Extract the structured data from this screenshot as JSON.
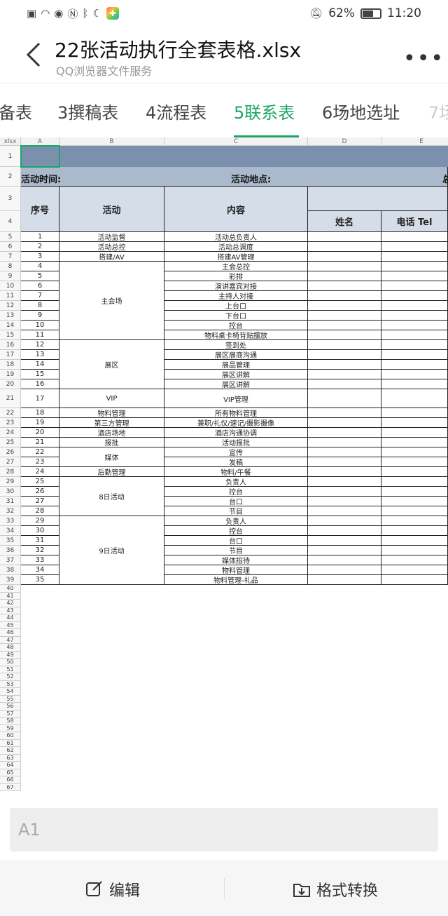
{
  "status_bar": {
    "battery": "62%",
    "time": "11:20",
    "battery_level": 0.62
  },
  "header": {
    "title": "22张活动执行全套表格.xlsx",
    "subtitle": "QQ浏览器文件服务"
  },
  "tabs": [
    "备表",
    "3撰稿表",
    "4流程表",
    "5联系表",
    "6场地选址",
    "7场"
  ],
  "active_tab": "5联系表",
  "sheet": {
    "corner": "xlsx",
    "columns": [
      "A",
      "B",
      "C",
      "D",
      "E"
    ],
    "row2": {
      "time_label": "活动时间:",
      "place_label": "活动地点:",
      "edge": "总"
    },
    "headers": {
      "seq": "序号",
      "activity": "活动",
      "content": "内容",
      "name": "姓名",
      "phone": "电话 Tel"
    },
    "groups": [
      {
        "label": "活动监督",
        "rows": [
          5
        ]
      },
      {
        "label": "活动总控",
        "rows": [
          6
        ]
      },
      {
        "label": "搭建/AV",
        "rows": [
          7
        ]
      },
      {
        "label": "主会场",
        "rows": [
          8,
          9,
          10,
          11,
          12,
          13,
          14,
          15
        ]
      },
      {
        "label": "展区",
        "rows": [
          16,
          17,
          18,
          19,
          20
        ]
      },
      {
        "label": "VIP",
        "rows": [
          21
        ]
      },
      {
        "label": "物料管理",
        "rows": [
          22
        ]
      },
      {
        "label": "第三方管理",
        "rows": [
          23
        ]
      },
      {
        "label": "酒店场地",
        "rows": [
          24
        ]
      },
      {
        "label": "报批",
        "rows": [
          25
        ]
      },
      {
        "label": "媒体",
        "rows": [
          26,
          27
        ]
      },
      {
        "label": "后勤管理",
        "rows": [
          28
        ]
      },
      {
        "label": "8日活动",
        "rows": [
          29,
          30,
          31,
          32
        ]
      },
      {
        "label": "9日活动",
        "rows": [
          33,
          34,
          35,
          36,
          37,
          38,
          39
        ]
      }
    ],
    "rows": [
      {
        "seq": "1",
        "content": "活动总负责人"
      },
      {
        "seq": "2",
        "content": "活动总调度"
      },
      {
        "seq": "3",
        "content": "搭建AV管理"
      },
      {
        "seq": "4",
        "content": "主会总控"
      },
      {
        "seq": "5",
        "content": "彩排"
      },
      {
        "seq": "6",
        "content": "演讲嘉宾对接"
      },
      {
        "seq": "7",
        "content": "主持人对接"
      },
      {
        "seq": "8",
        "content": "上台口"
      },
      {
        "seq": "9",
        "content": "下台口"
      },
      {
        "seq": "10",
        "content": "控台"
      },
      {
        "seq": "11",
        "content": "物料桌卡椅背贴摆放"
      },
      {
        "seq": "12",
        "content": "签到处"
      },
      {
        "seq": "13",
        "content": "展区展商沟通"
      },
      {
        "seq": "14",
        "content": "展品管理"
      },
      {
        "seq": "15",
        "content": "展区讲解"
      },
      {
        "seq": "16",
        "content": "展区讲解"
      },
      {
        "seq": "17",
        "content": "VIP管理"
      },
      {
        "seq": "18",
        "content": "所有物料管理"
      },
      {
        "seq": "19",
        "content": "兼职/礼仪/速记/摄影摄像"
      },
      {
        "seq": "20",
        "content": "酒店沟通协调"
      },
      {
        "seq": "21",
        "content": "活动报批"
      },
      {
        "seq": "22",
        "content": "宣传"
      },
      {
        "seq": "23",
        "content": "发稿"
      },
      {
        "seq": "24",
        "content": "物料/午餐"
      },
      {
        "seq": "25",
        "content": "负责人"
      },
      {
        "seq": "26",
        "content": "控台"
      },
      {
        "seq": "27",
        "content": "台口"
      },
      {
        "seq": "28",
        "content": "节目"
      },
      {
        "seq": "29",
        "content": "负责人"
      },
      {
        "seq": "30",
        "content": "控台"
      },
      {
        "seq": "31",
        "content": "台口"
      },
      {
        "seq": "32",
        "content": "节目"
      },
      {
        "seq": "33",
        "content": "媒体招待"
      },
      {
        "seq": "34",
        "content": "物料管理"
      },
      {
        "seq": "35",
        "content": "物料管理-礼品"
      }
    ],
    "row_numbers_total": 67
  },
  "cell_address": "A1",
  "footer": {
    "edit_label": "编辑",
    "convert_label": "格式转换"
  },
  "colors": {
    "accent": "#1aa566",
    "header_dark": "#7b90ad",
    "header_mid": "#aab9cc",
    "header_light": "#d5dde8"
  },
  "icons": [
    "back-arrow-icon",
    "more-icon",
    "edit-icon",
    "convert-icon",
    "notification-muted-icon",
    "wifi-icon",
    "eye-icon",
    "nfc-icon",
    "bluetooth-icon",
    "moon-icon"
  ]
}
